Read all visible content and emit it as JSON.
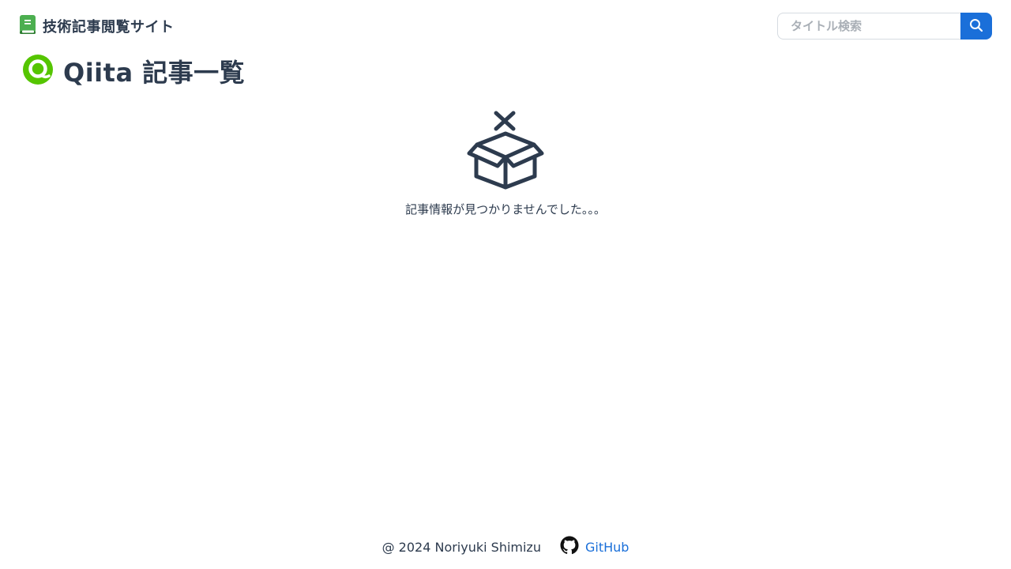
{
  "header": {
    "site_title": "技術記事閲覧サイト",
    "search_placeholder": "タイトル検索",
    "search_value": ""
  },
  "main": {
    "heading": "Qiita 記事一覧",
    "empty_message": "記事情報が見つかりませんでした。。。"
  },
  "footer": {
    "copyright": "@ 2024 Noriyuki Shimizu",
    "github_label": "GitHub"
  },
  "colors": {
    "text": "#2d3b4e",
    "accent_blue": "#1a6fd9",
    "qiita_green": "#55c500",
    "book_green": "#4caf50"
  },
  "icons": {
    "brand": "book-icon",
    "search": "search-icon",
    "qiita": "qiita-logo-icon",
    "empty": "empty-box-icon",
    "github": "github-icon"
  }
}
